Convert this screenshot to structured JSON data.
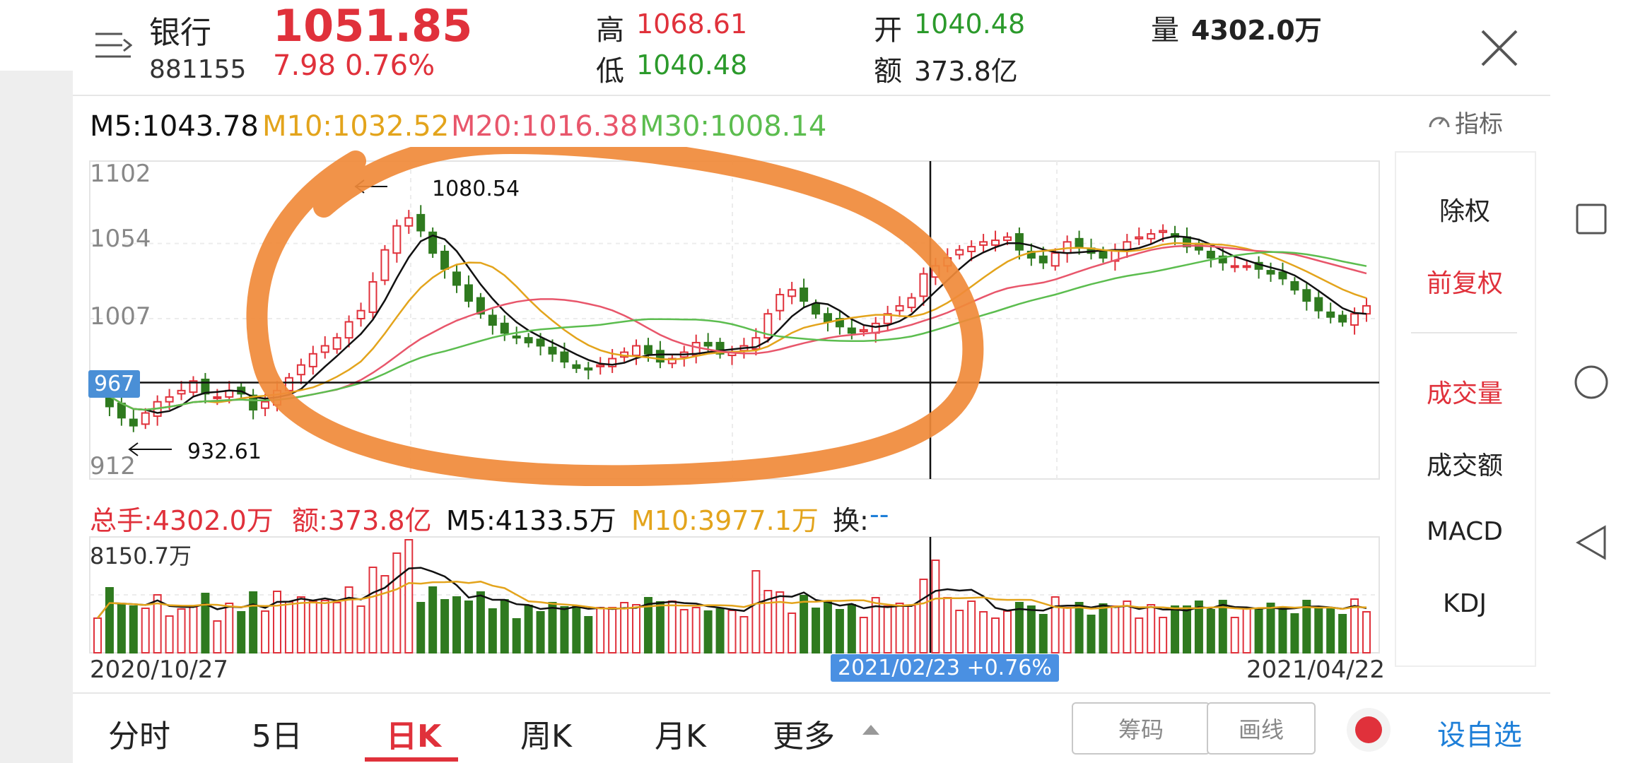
{
  "header": {
    "name": "银行",
    "code": "881155",
    "price": "1051.85",
    "change": "7.98",
    "change_pct": "0.76%",
    "high_label": "高",
    "high": "1068.61",
    "low_label": "低",
    "low": "1040.48",
    "open_label": "开",
    "open": "1040.48",
    "amount_label": "额",
    "amount": "373.8亿",
    "volume_label": "量",
    "volume": "4302.0万"
  },
  "ma": {
    "m5": "M5:1043.78",
    "m10": "M10:1032.52",
    "m20": "M20:1016.38",
    "m30": "M30:1008.14"
  },
  "indicator_button": "指标",
  "price_axis": {
    "top": "1102",
    "mid1": "1054",
    "mid2": "1007",
    "bottom": "912",
    "crosshair": "967"
  },
  "annotations": {
    "max": "1080.54",
    "min": "932.61"
  },
  "volume_info": {
    "total": "总手:4302.0万",
    "amount": "额:373.8亿",
    "m5": "M5:4133.5万",
    "m10": "M10:3977.1万",
    "turnover_label": "换:",
    "turnover_value": "--",
    "max_label": "8150.7万"
  },
  "dates": {
    "start": "2020/10/27",
    "cursor": "2021/02/23  +0.76%",
    "end": "2021/04/22"
  },
  "side_menu": [
    "除权",
    "前复权",
    "成交量",
    "成交额",
    "MACD",
    "KDJ"
  ],
  "tabs": [
    "分时",
    "5日",
    "日K",
    "周K",
    "月K",
    "更多"
  ],
  "active_tab": "日K",
  "buttons": {
    "chips": "筹码",
    "draw": "画线",
    "add_watch": "设自选"
  },
  "colors": {
    "up": "#e0313b",
    "down": "#2f7a1f",
    "m5": "#111111",
    "m10": "#e3a41c",
    "m20": "#e8566b",
    "m30": "#5cbd4f",
    "accent": "#1e7fd8",
    "overlay": "#f08a3a"
  },
  "chart_data": {
    "type": "candlestick",
    "x": [
      "2020/10/27",
      "2021/02/23",
      "2021/04/22"
    ],
    "ylim": [
      912,
      1102
    ],
    "ticks": [
      1102,
      1054,
      1007,
      912
    ],
    "annotations": [
      {
        "label": "1080.54",
        "kind": "max"
      },
      {
        "label": "932.61",
        "kind": "min"
      }
    ],
    "closes": [
      965,
      952,
      945,
      940,
      948,
      955,
      958,
      962,
      968,
      960,
      958,
      962,
      960,
      950,
      955,
      962,
      970,
      978,
      985,
      990,
      995,
      1005,
      1012,
      1030,
      1050,
      1065,
      1070,
      1062,
      1048,
      1038,
      1028,
      1018,
      1010,
      1003,
      998,
      995,
      992,
      990,
      985,
      980,
      976,
      975,
      978,
      982,
      986,
      990,
      985,
      980,
      982,
      986,
      992,
      990,
      985,
      986,
      990,
      995,
      1010,
      1022,
      1025,
      1018,
      1010,
      1005,
      1002,
      998,
      1000,
      1004,
      1010,
      1015,
      1020,
      1035,
      1040,
      1045,
      1050,
      1052,
      1055,
      1056,
      1058,
      1050,
      1045,
      1042,
      1048,
      1055,
      1052,
      1048,
      1045,
      1050,
      1055,
      1058,
      1060,
      1062,
      1058,
      1052,
      1050,
      1045,
      1042,
      1040,
      1040,
      1038,
      1035,
      1032,
      1025,
      1018,
      1012,
      1008,
      1005,
      1010,
      1015
    ]
  }
}
